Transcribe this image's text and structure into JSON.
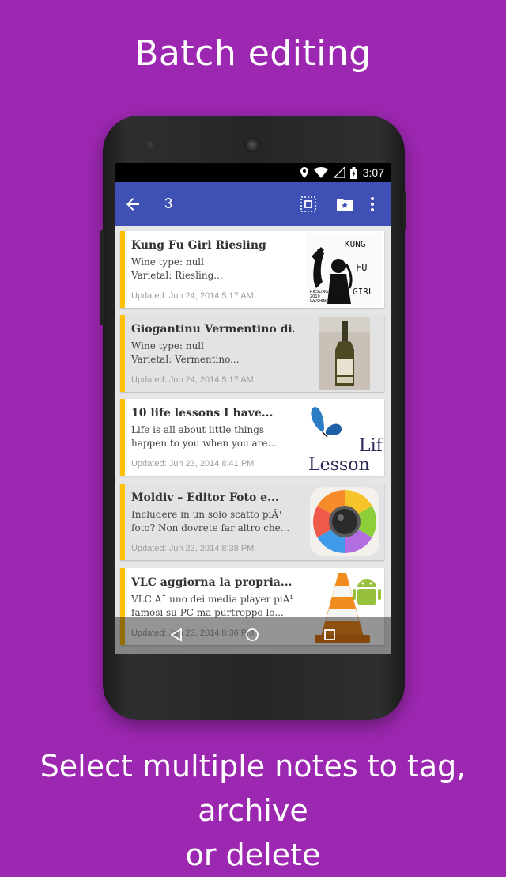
{
  "promo": {
    "headline": "Batch editing",
    "subline_1": "Select multiple notes to tag, archive",
    "subline_2": "or delete"
  },
  "status_bar": {
    "time": "3:07",
    "icons": [
      "location-icon",
      "wifi-icon",
      "signal-icon",
      "battery-icon"
    ]
  },
  "app_bar": {
    "selected_count": "3",
    "background": "#3f51b5",
    "actions": [
      "select-all-icon",
      "folder-star-icon",
      "overflow-menu-icon"
    ]
  },
  "notes": [
    {
      "title": "Kung Fu Girl Riesling",
      "line1": "Wine type: null",
      "line2": "Varietal: Riesling...",
      "updated": "Updated: Jun 24, 2014 5:17 AM",
      "thumb": "wine-label-thumbnail",
      "selected": false,
      "thumb_text": {
        "kung": "KUNG",
        "fu": "FU",
        "girl": "GIRL",
        "small1": "RIESLING",
        "small2": "2010",
        "small3": "WASHINGTON STATE"
      }
    },
    {
      "title": "Giogantinu Vermentino di...",
      "line1": "Wine type: null",
      "line2": "Varietal: Vermentino...",
      "updated": "Updated: Jun 24, 2014 5:17 AM",
      "thumb": "wine-bottle-thumbnail",
      "selected": true
    },
    {
      "title": "10 life lessons I have...",
      "line1": "Life is all about little things",
      "line2": "happen to you when you are...",
      "updated": "Updated: Jun 23, 2014 8:41 PM",
      "thumb": "butterfly-thumbnail",
      "selected": false,
      "thumb_text": {
        "a": "Lif",
        "b": "Lesson"
      }
    },
    {
      "title": "Moldiv – Editor Foto e...",
      "line1": "Includere in un solo scatto piÃ¹",
      "line2": "foto? Non dovrete far altro che...",
      "updated": "Updated: Jun 23, 2014 8:38 PM",
      "thumb": "moldiv-app-icon-thumbnail",
      "selected": true
    },
    {
      "title": "VLC aggiorna la propria...",
      "line1": "VLC Ã¨ uno dei media player piÃ¹",
      "line2": "famosi su PC ma purtroppo lo...",
      "updated": "Updated: Jun 23, 2014 8:36 PM",
      "thumb": "vlc-cone-thumbnail",
      "selected": false
    }
  ],
  "colors": {
    "background": "#9c27b0",
    "accent_stripe": "#ffc107"
  }
}
